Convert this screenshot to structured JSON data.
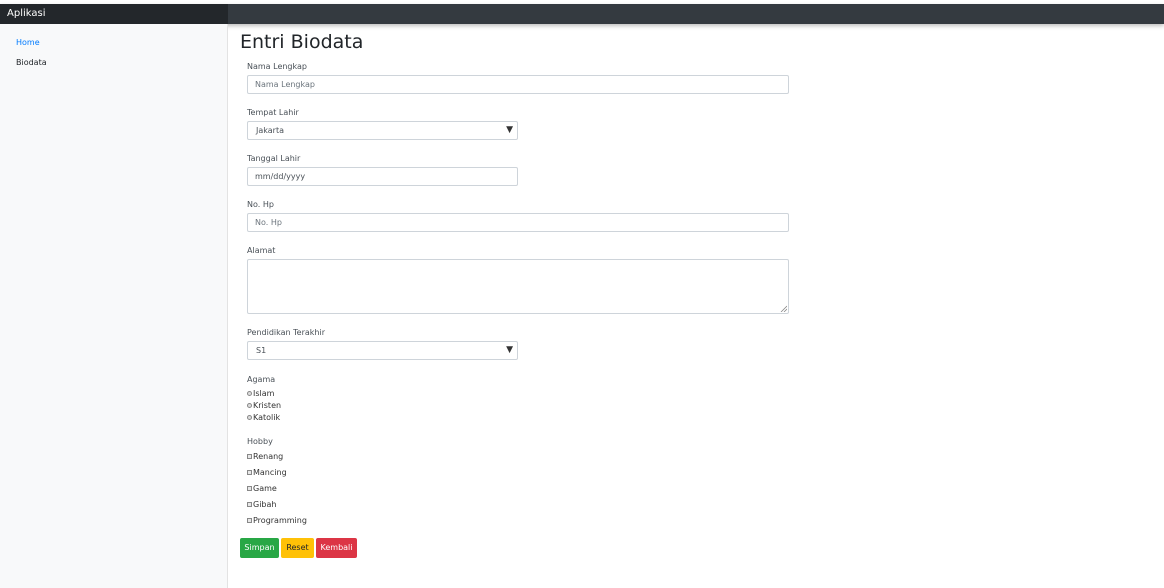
{
  "app": {
    "brand": "Aplikasi"
  },
  "sidebar": {
    "items": [
      {
        "label": "Home"
      },
      {
        "label": "Biodata"
      }
    ]
  },
  "page": {
    "title": "Entri Biodata"
  },
  "form": {
    "nama": {
      "label": "Nama Lengkap",
      "placeholder": "Nama Lengkap"
    },
    "tempat": {
      "label": "Tempat Lahir",
      "value": "Jakarta"
    },
    "tanggal": {
      "label": "Tanggal Lahir",
      "placeholder": "mm/dd/yyyy"
    },
    "hp": {
      "label": "No. Hp",
      "placeholder": "No. Hp"
    },
    "alamat": {
      "label": "Alamat"
    },
    "pendidikan": {
      "label": "Pendidikan Terakhir",
      "value": "S1"
    },
    "agama": {
      "label": "Agama",
      "options": [
        "Islam",
        "Kristen",
        "Katolik"
      ]
    },
    "hobby": {
      "label": "Hobby",
      "options": [
        "Renang",
        "Mancing",
        "Game",
        "Gibah",
        "Programming"
      ]
    }
  },
  "buttons": {
    "save": "Simpan",
    "reset": "Reset",
    "back": "Kembali"
  },
  "icons": {
    "select_arrow": "▼"
  },
  "colors": {
    "navbar": "#343a40",
    "brand_bg": "#23272b",
    "save": "#28a745",
    "reset": "#ffc107",
    "back": "#dc3545",
    "link_active": "#007bff"
  }
}
